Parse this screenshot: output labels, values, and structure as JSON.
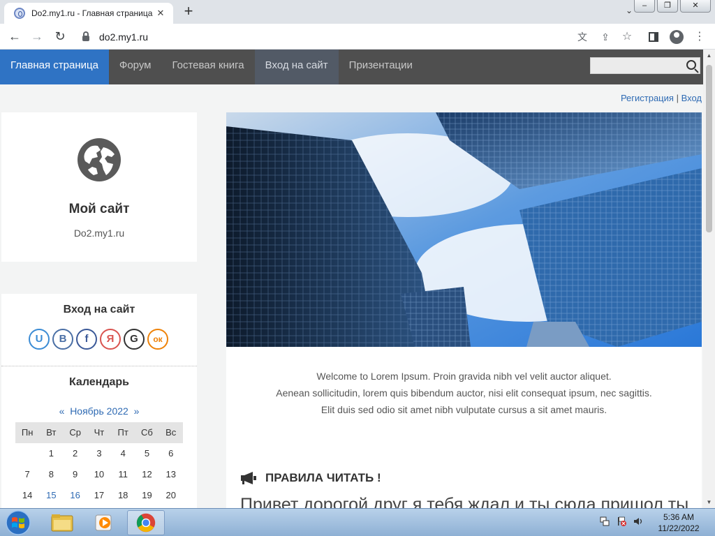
{
  "browser": {
    "tab_title": "Do2.my1.ru - Главная страница",
    "url": "do2.my1.ru"
  },
  "site": {
    "nav": [
      {
        "label": "Главная страница"
      },
      {
        "label": "Форум"
      },
      {
        "label": "Гостевая книга"
      },
      {
        "label": "Вход на сайт"
      },
      {
        "label": "Призентации"
      }
    ],
    "search": {
      "value": ""
    },
    "auth": {
      "register": "Регистрация",
      "separator": "|",
      "login": "Вход"
    },
    "sidebar": {
      "site_title": "Мой сайт",
      "site_subtitle": "Do2.my1.ru",
      "login_title": "Вход на сайт",
      "socials": [
        {
          "label": "U",
          "color": "#3a8bd4"
        },
        {
          "label": "B",
          "color": "#4a6fa5"
        },
        {
          "label": "f",
          "color": "#3b5998"
        },
        {
          "label": "Я",
          "color": "#d9534f"
        },
        {
          "label": "G",
          "color": "#333333"
        },
        {
          "label": "ок",
          "color": "#ee8208"
        }
      ],
      "calendar": {
        "title": "Календарь",
        "prev": "«",
        "month": "Ноябрь 2022",
        "next": "»",
        "weekdays": [
          "Пн",
          "Вт",
          "Ср",
          "Чт",
          "Пт",
          "Сб",
          "Вс"
        ],
        "weeks": [
          [
            "",
            "1",
            "2",
            "3",
            "4",
            "5",
            "6"
          ],
          [
            "7",
            "8",
            "9",
            "10",
            "11",
            "12",
            "13"
          ],
          [
            "14",
            "15",
            "16",
            "17",
            "18",
            "19",
            "20"
          ]
        ]
      }
    },
    "welcome_lines": [
      "Welcome to Lorem Ipsum. Proin gravida nibh vel velit auctor aliquet.",
      "Aenean sollicitudin, lorem quis bibendum auctor, nisi elit consequat ipsum, nec sagittis.",
      "Elit duis sed odio sit amet nibh vulputate cursus a sit amet mauris."
    ],
    "rules_title": "ПРАВИЛА ЧИТАТЬ !",
    "greeting": "Привет дорогой друг я тебя ждал и ты сюда пришол ты"
  },
  "taskbar": {
    "time": "5:36 AM",
    "date": "11/22/2022"
  },
  "colors": {
    "nav_bg": "#4f4f4f",
    "nav_active": "#2f73c4",
    "link": "#2e6ab3"
  }
}
